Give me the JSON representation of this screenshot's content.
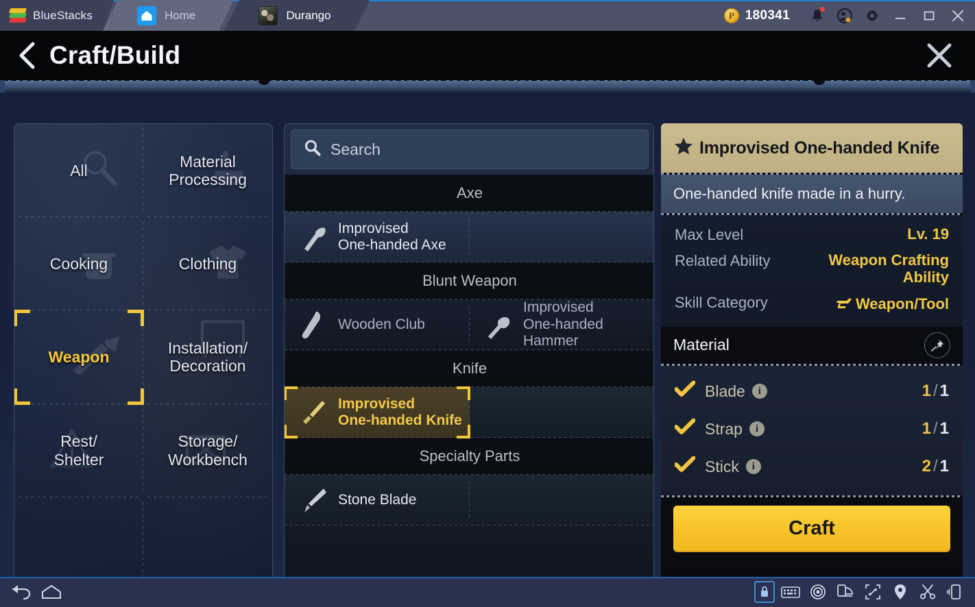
{
  "bluestacks": {
    "brand": "BlueStacks",
    "tabs": [
      {
        "label": "Home",
        "icon": "home-icon",
        "active": false
      },
      {
        "label": "Durango",
        "icon": "game-app-icon",
        "active": true
      }
    ],
    "coin_symbol": "P",
    "coin_amount": "180341",
    "icons": [
      "bell-icon",
      "account-star-icon",
      "gear-icon",
      "minimize-icon",
      "maximize-icon",
      "close-icon"
    ],
    "accent_blue": "#1f7fd0",
    "titlebar_bg": "#4b5168"
  },
  "header": {
    "back_icon": "back-chevron-icon",
    "title": "Craft/Build",
    "close_icon": "close-icon"
  },
  "categories": {
    "items": [
      {
        "label": "All",
        "ghost_icon": "magnifier-icon",
        "selected": false
      },
      {
        "label": "Material\nProcessing",
        "ghost_icon": "mortar-icon",
        "selected": false
      },
      {
        "label": "Cooking",
        "ghost_icon": "pot-icon",
        "selected": false
      },
      {
        "label": "Clothing",
        "ghost_icon": "shirt-icon",
        "selected": false
      },
      {
        "label": "Weapon",
        "ghost_icon": "knife-icon",
        "selected": true
      },
      {
        "label": "Installation/\nDecoration",
        "ghost_icon": "frame-icon",
        "selected": false
      },
      {
        "label": "Rest/\nShelter",
        "ghost_icon": "tent-icon",
        "selected": false
      },
      {
        "label": "Storage/\nWorkbench",
        "ghost_icon": "crate-icon",
        "selected": false
      }
    ],
    "selected_color": "#f5c63c"
  },
  "search": {
    "icon": "search-icon",
    "placeholder": "Search",
    "value": ""
  },
  "recipe_list": {
    "groups": [
      {
        "title": "Axe",
        "rows": [
          [
            {
              "name": "Improvised\nOne-handed Axe",
              "icon": "axe-icon",
              "selected": false,
              "dim": false
            },
            {
              "name": "",
              "icon": "",
              "empty": true
            }
          ]
        ]
      },
      {
        "title": "Blunt Weapon",
        "rows": [
          [
            {
              "name": "Wooden Club",
              "icon": "club-icon",
              "selected": false,
              "dim": true
            },
            {
              "name": "Improvised\nOne-handed Hammer",
              "icon": "hammer-icon",
              "selected": false,
              "dim": true
            }
          ]
        ]
      },
      {
        "title": "Knife",
        "rows": [
          [
            {
              "name": "Improvised\nOne-handed Knife",
              "icon": "knife-icon",
              "selected": true,
              "dim": false
            },
            {
              "name": "",
              "icon": "",
              "empty": true
            }
          ]
        ]
      },
      {
        "title": "Specialty Parts",
        "rows": [
          [
            {
              "name": "Stone Blade",
              "icon": "stone-blade-icon",
              "selected": false,
              "dim": false
            },
            {
              "name": "",
              "icon": "",
              "empty": true
            }
          ]
        ]
      }
    ]
  },
  "detail": {
    "star_icon": "star-icon",
    "title": "Improvised One-handed Knife",
    "description": "One-handed knife made in a hurry.",
    "stats": [
      {
        "key": "Max Level",
        "value": "Lv. 19",
        "icon": ""
      },
      {
        "key": "Related Ability",
        "value": "Weapon Crafting Ability",
        "icon": ""
      },
      {
        "key": "Skill Category",
        "value": "Weapon/Tool",
        "icon": "anvil-icon"
      }
    ],
    "material_header": "Material",
    "pin_icon": "pin-icon",
    "materials": [
      {
        "name": "Blade",
        "have": "1",
        "need": "1",
        "checked": true,
        "info_icon": "info-icon"
      },
      {
        "name": "Strap",
        "have": "1",
        "need": "1",
        "checked": true,
        "info_icon": "info-icon"
      },
      {
        "name": "Stick",
        "have": "2",
        "need": "1",
        "checked": true,
        "info_icon": "info-icon"
      }
    ],
    "craft_label": "Craft",
    "craft_color": "#f9c22a",
    "title_bg": "#c3b488"
  },
  "bottom_bar": {
    "left_icons": [
      "back-arrow-icon",
      "home-outline-icon"
    ],
    "right_icons": [
      "lock-orientation-icon",
      "keyboard-icon",
      "eye-target-icon",
      "rotate-device-icon",
      "fullscreen-icon",
      "location-pin-icon",
      "scissors-icon",
      "shake-device-icon"
    ]
  }
}
